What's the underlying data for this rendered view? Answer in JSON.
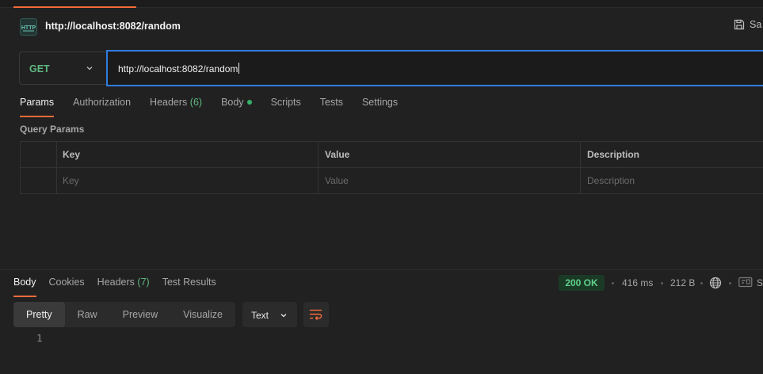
{
  "request": {
    "title": "http://localhost:8082/random",
    "save_label": "Sa",
    "method": "GET",
    "url": "http://localhost:8082/random"
  },
  "request_tabs": [
    {
      "label": "Params",
      "active": true
    },
    {
      "label": "Authorization"
    },
    {
      "label": "Headers",
      "count": "(6)"
    },
    {
      "label": "Body",
      "dot": true
    },
    {
      "label": "Scripts"
    },
    {
      "label": "Tests"
    },
    {
      "label": "Settings"
    }
  ],
  "query_params": {
    "label": "Query Params",
    "columns": [
      "Key",
      "Value",
      "Description"
    ],
    "placeholders": [
      "Key",
      "Value",
      "Description"
    ]
  },
  "response": {
    "tabs": [
      {
        "label": "Body",
        "active": true
      },
      {
        "label": "Cookies"
      },
      {
        "label": "Headers",
        "count": "(7)"
      },
      {
        "label": "Test Results"
      }
    ],
    "status": "200 OK",
    "time": "416 ms",
    "size": "212 B",
    "trailing": "S",
    "views": [
      "Pretty",
      "Raw",
      "Preview",
      "Visualize"
    ],
    "format": "Text",
    "line_numbers": [
      "1"
    ]
  },
  "colors": {
    "accent": "#f26b3a",
    "focus": "#2f7de1",
    "method_get": "#5fb881",
    "status_ok": "#5fd08b"
  },
  "icons": [
    "http-icon",
    "save-icon",
    "chevron-down-icon",
    "globe-icon",
    "save-response-icon",
    "wrap-lines-icon"
  ]
}
